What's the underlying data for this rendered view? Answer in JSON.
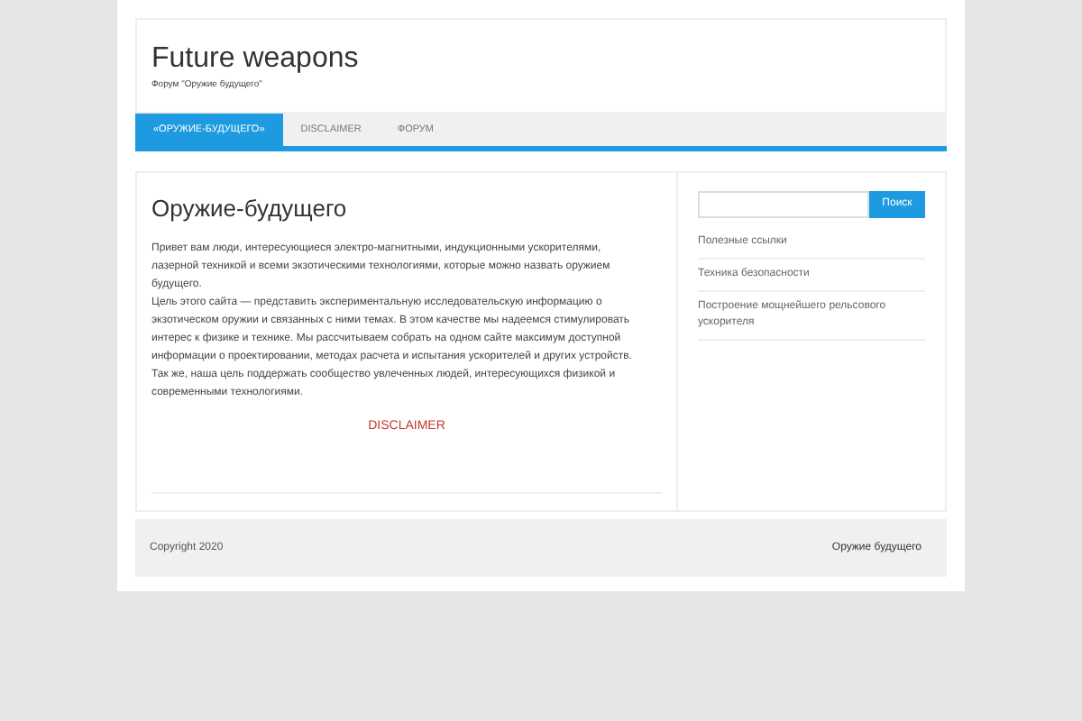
{
  "site": {
    "title": "Future weapons",
    "tagline": "Форум \"Оружие будущего\""
  },
  "nav": [
    {
      "label": "«ОРУЖИЕ-БУДУЩЕГО»",
      "selected": true
    },
    {
      "label": "DISCLAIMER",
      "selected": false
    },
    {
      "label": "ФОРУМ",
      "selected": false
    }
  ],
  "article": {
    "title": "Оружие-будущего",
    "paragraphs": [
      "Привет вам люди, интересующиеся электро-магнитными, индукционными ускорителями, лазерной техникой и всеми экзотическими технологиями, которые можно назвать оружием будущего.",
      "Цель этого сайта — представить экспериментальную исследовательскую информацию о экзотическом оружии и связанных с ними темах. В этом качестве мы надеемся стимулировать интерес к физике и технике. Мы рассчитываем собрать на одном сайте максимум доступной информации о проектировании, методах расчета и испытания ускорителей и других устройств.",
      "Так же, наша цель поддержать сообщество увлеченных людей, интересующихся физикой и современными технологиями."
    ],
    "link": "DISCLAIMER"
  },
  "sidebar": {
    "search_button": "Поиск",
    "links": [
      "Полезные ссылки",
      "Техника безопасности",
      "Построение мощнейшего рельсового ускорителя"
    ]
  },
  "footer": {
    "copyright": "Copyright 2020",
    "site_name": "Оружие будущего"
  }
}
